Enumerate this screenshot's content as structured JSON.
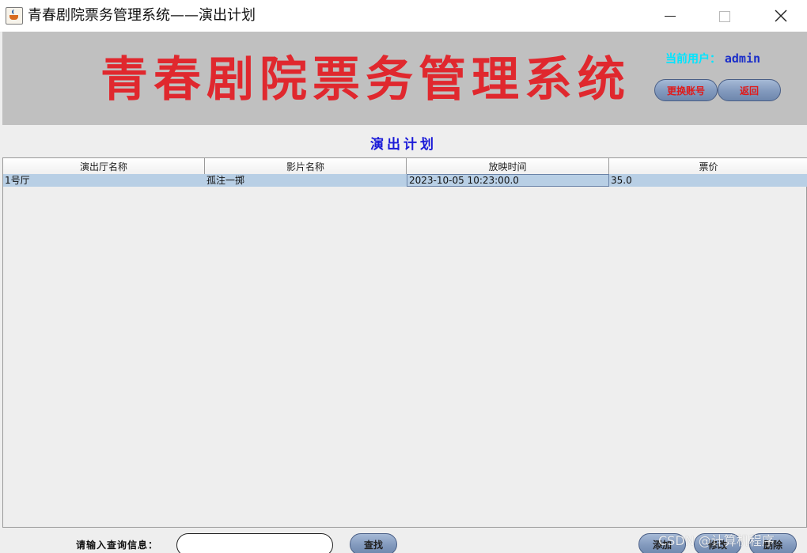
{
  "window": {
    "title": "青春剧院票务管理系统——演出计划"
  },
  "banner": {
    "title": "青春剧院票务管理系统",
    "current_user_label": "当前用户：",
    "current_user_name": "admin",
    "switch_account_label": "更换账号",
    "back_label": "返回"
  },
  "page": {
    "heading": "演出计划"
  },
  "table": {
    "columns": [
      "演出厅名称",
      "影片名称",
      "放映时间",
      "票价"
    ],
    "rows": [
      [
        "1号厅",
        "孤注一掷",
        "2023-10-05 10:23:00.0",
        "35.0"
      ]
    ]
  },
  "footer": {
    "search_label": "请输入查询信息：",
    "search_value": "",
    "search_button": "查找",
    "add_button": "添加",
    "edit_button": "修改",
    "delete_button": "删除"
  },
  "watermark": "CSDN @计算机程序"
}
